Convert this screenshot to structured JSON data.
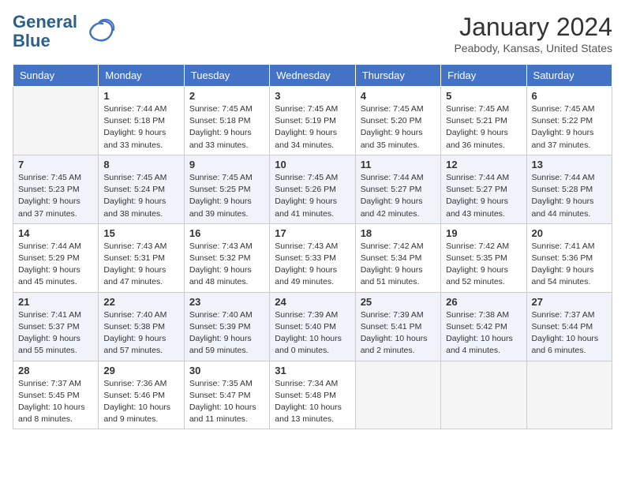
{
  "header": {
    "logo_line1": "General",
    "logo_line2": "Blue",
    "title": "January 2024",
    "subtitle": "Peabody, Kansas, United States"
  },
  "weekdays": [
    "Sunday",
    "Monday",
    "Tuesday",
    "Wednesday",
    "Thursday",
    "Friday",
    "Saturday"
  ],
  "weeks": [
    [
      {
        "day": "",
        "empty": true
      },
      {
        "day": "1",
        "sunrise": "7:44 AM",
        "sunset": "5:18 PM",
        "daylight": "9 hours and 33 minutes."
      },
      {
        "day": "2",
        "sunrise": "7:45 AM",
        "sunset": "5:18 PM",
        "daylight": "9 hours and 33 minutes."
      },
      {
        "day": "3",
        "sunrise": "7:45 AM",
        "sunset": "5:19 PM",
        "daylight": "9 hours and 34 minutes."
      },
      {
        "day": "4",
        "sunrise": "7:45 AM",
        "sunset": "5:20 PM",
        "daylight": "9 hours and 35 minutes."
      },
      {
        "day": "5",
        "sunrise": "7:45 AM",
        "sunset": "5:21 PM",
        "daylight": "9 hours and 36 minutes."
      },
      {
        "day": "6",
        "sunrise": "7:45 AM",
        "sunset": "5:22 PM",
        "daylight": "9 hours and 37 minutes."
      }
    ],
    [
      {
        "day": "7",
        "sunrise": "7:45 AM",
        "sunset": "5:23 PM",
        "daylight": "9 hours and 37 minutes."
      },
      {
        "day": "8",
        "sunrise": "7:45 AM",
        "sunset": "5:24 PM",
        "daylight": "9 hours and 38 minutes."
      },
      {
        "day": "9",
        "sunrise": "7:45 AM",
        "sunset": "5:25 PM",
        "daylight": "9 hours and 39 minutes."
      },
      {
        "day": "10",
        "sunrise": "7:45 AM",
        "sunset": "5:26 PM",
        "daylight": "9 hours and 41 minutes."
      },
      {
        "day": "11",
        "sunrise": "7:44 AM",
        "sunset": "5:27 PM",
        "daylight": "9 hours and 42 minutes."
      },
      {
        "day": "12",
        "sunrise": "7:44 AM",
        "sunset": "5:27 PM",
        "daylight": "9 hours and 43 minutes."
      },
      {
        "day": "13",
        "sunrise": "7:44 AM",
        "sunset": "5:28 PM",
        "daylight": "9 hours and 44 minutes."
      }
    ],
    [
      {
        "day": "14",
        "sunrise": "7:44 AM",
        "sunset": "5:29 PM",
        "daylight": "9 hours and 45 minutes."
      },
      {
        "day": "15",
        "sunrise": "7:43 AM",
        "sunset": "5:31 PM",
        "daylight": "9 hours and 47 minutes."
      },
      {
        "day": "16",
        "sunrise": "7:43 AM",
        "sunset": "5:32 PM",
        "daylight": "9 hours and 48 minutes."
      },
      {
        "day": "17",
        "sunrise": "7:43 AM",
        "sunset": "5:33 PM",
        "daylight": "9 hours and 49 minutes."
      },
      {
        "day": "18",
        "sunrise": "7:42 AM",
        "sunset": "5:34 PM",
        "daylight": "9 hours and 51 minutes."
      },
      {
        "day": "19",
        "sunrise": "7:42 AM",
        "sunset": "5:35 PM",
        "daylight": "9 hours and 52 minutes."
      },
      {
        "day": "20",
        "sunrise": "7:41 AM",
        "sunset": "5:36 PM",
        "daylight": "9 hours and 54 minutes."
      }
    ],
    [
      {
        "day": "21",
        "sunrise": "7:41 AM",
        "sunset": "5:37 PM",
        "daylight": "9 hours and 55 minutes."
      },
      {
        "day": "22",
        "sunrise": "7:40 AM",
        "sunset": "5:38 PM",
        "daylight": "9 hours and 57 minutes."
      },
      {
        "day": "23",
        "sunrise": "7:40 AM",
        "sunset": "5:39 PM",
        "daylight": "9 hours and 59 minutes."
      },
      {
        "day": "24",
        "sunrise": "7:39 AM",
        "sunset": "5:40 PM",
        "daylight": "10 hours and 0 minutes."
      },
      {
        "day": "25",
        "sunrise": "7:39 AM",
        "sunset": "5:41 PM",
        "daylight": "10 hours and 2 minutes."
      },
      {
        "day": "26",
        "sunrise": "7:38 AM",
        "sunset": "5:42 PM",
        "daylight": "10 hours and 4 minutes."
      },
      {
        "day": "27",
        "sunrise": "7:37 AM",
        "sunset": "5:44 PM",
        "daylight": "10 hours and 6 minutes."
      }
    ],
    [
      {
        "day": "28",
        "sunrise": "7:37 AM",
        "sunset": "5:45 PM",
        "daylight": "10 hours and 8 minutes."
      },
      {
        "day": "29",
        "sunrise": "7:36 AM",
        "sunset": "5:46 PM",
        "daylight": "10 hours and 9 minutes."
      },
      {
        "day": "30",
        "sunrise": "7:35 AM",
        "sunset": "5:47 PM",
        "daylight": "10 hours and 11 minutes."
      },
      {
        "day": "31",
        "sunrise": "7:34 AM",
        "sunset": "5:48 PM",
        "daylight": "10 hours and 13 minutes."
      },
      {
        "day": "",
        "empty": true
      },
      {
        "day": "",
        "empty": true
      },
      {
        "day": "",
        "empty": true
      }
    ]
  ]
}
